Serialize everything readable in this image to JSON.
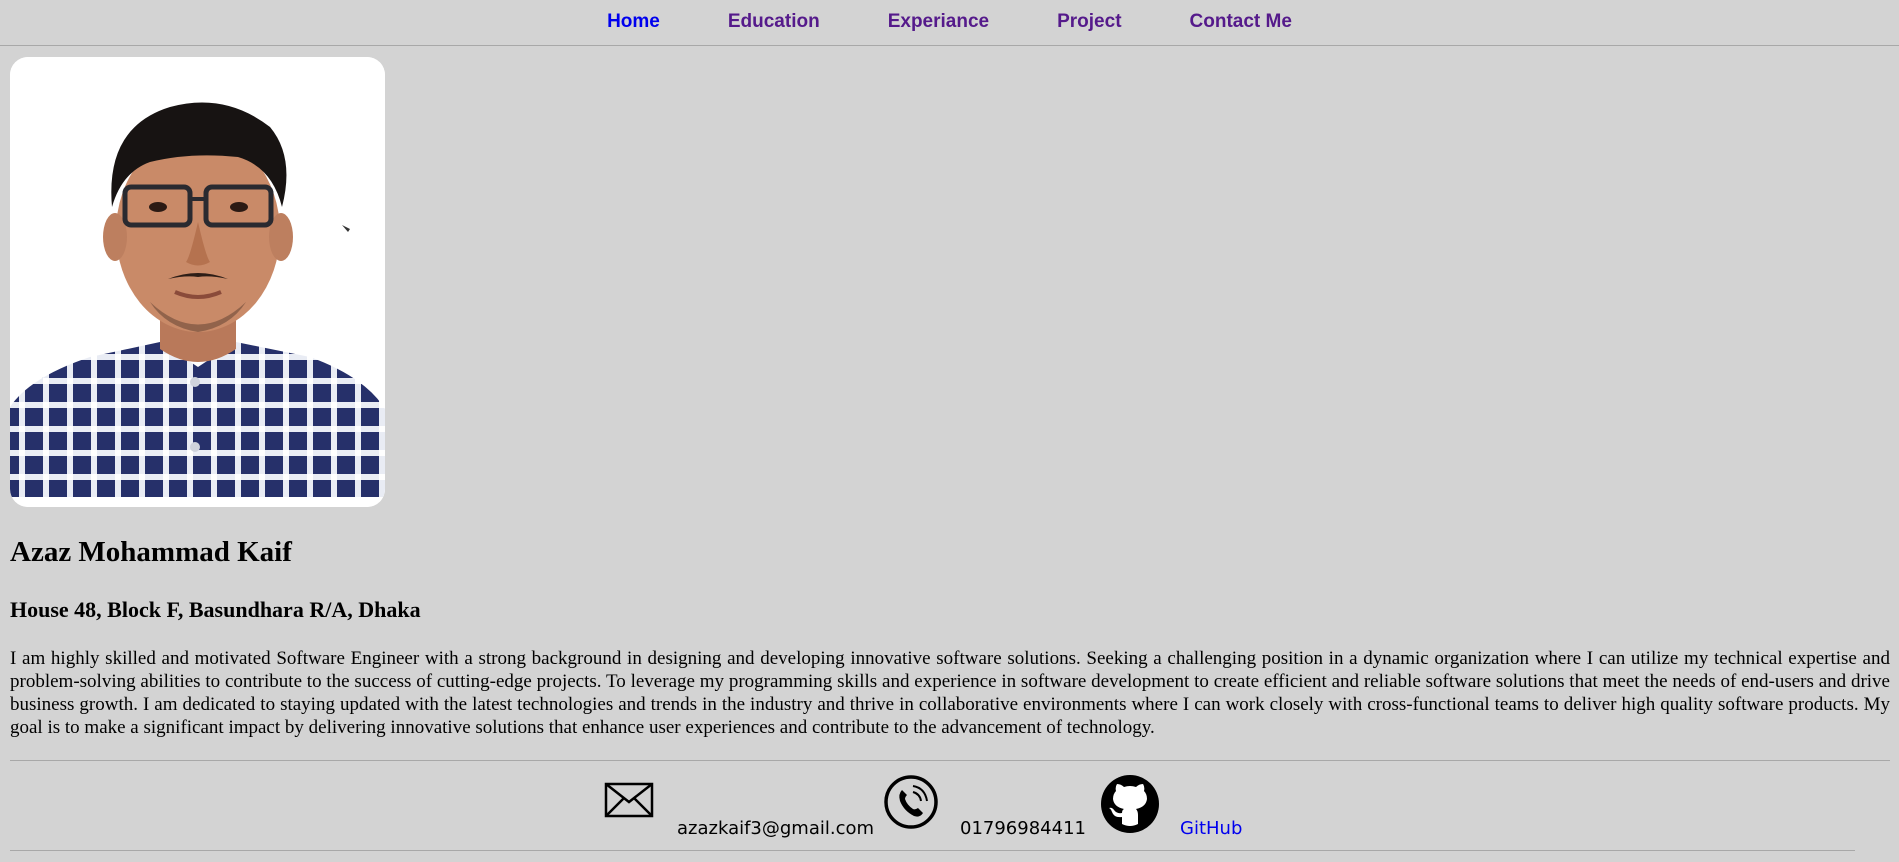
{
  "nav": {
    "items": [
      {
        "label": "Home"
      },
      {
        "label": "Education"
      },
      {
        "label": "Experiance"
      },
      {
        "label": "Project"
      },
      {
        "label": "Contact Me"
      }
    ]
  },
  "profile": {
    "photo_icon": "profile-photo",
    "name": "Azaz Mohammad Kaif",
    "address": "House 48, Block F, Basundhara R/A, Dhaka",
    "bio": "I am highly skilled and motivated Software Engineer with a strong background in designing and developing innovative software solutions. Seeking a challenging position in a dynamic organization where I can utilize my technical expertise and problem-solving abilities to contribute to the success of cutting-edge projects. To leverage my programming skills and experience in software development to create efficient and reliable software solutions that meet the needs of end-users and drive business growth. I am dedicated to staying updated with the latest technologies and trends in the industry and thrive in collaborative environments where I can work closely with cross-functional teams to deliver high quality software products. My goal is to make a significant impact by delivering innovative solutions that enhance user experiences and contribute to the advancement of technology."
  },
  "contact": {
    "email": {
      "icon": "envelope-icon",
      "text": "azazkaif3@gmail.com"
    },
    "phone": {
      "icon": "phone-icon",
      "text": "01796984411"
    },
    "github": {
      "icon": "github-icon",
      "text": "GitHub"
    }
  },
  "colors": {
    "background": "#d3d3d3",
    "link": "#0000ee",
    "visited_link": "#551a8b"
  }
}
